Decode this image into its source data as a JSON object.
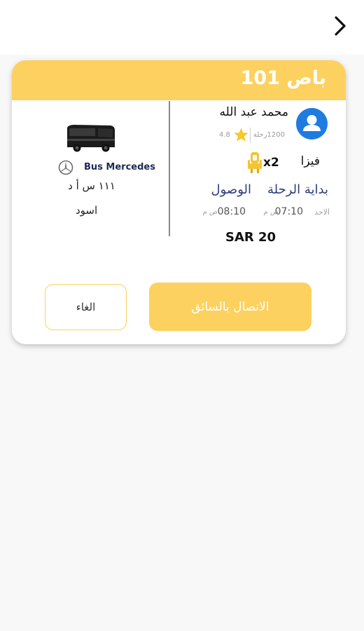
{
  "nav": {
    "back_icon": "chevron-right-icon"
  },
  "trip": {
    "bus_title": "باص 101",
    "driver": {
      "name": "محمد عبد الله",
      "trips": "1200رحلة",
      "rating": "4.8",
      "avatar_icon": "person-icon"
    },
    "payment_method": "فيزا",
    "seats": "x2",
    "start_label": "بداية الرحلة",
    "arrival_label": "الوصول",
    "start_day": "الاحد",
    "start_time": "07:10",
    "start_ampm": "ص م",
    "arrival_time": "08:10",
    "arrival_ampm": "ص م",
    "price": "SAR 20",
    "bus": {
      "model": "Bus Mercedes",
      "plate": "١١١ س أ د",
      "color": "اسود",
      "brand_icon": "mercedes-logo-icon"
    }
  },
  "actions": {
    "contact_label": "الاتصال بالسائق",
    "cancel_label": "الغاء"
  },
  "colors": {
    "accent": "#fdd15f",
    "label_blue": "#2c3d7e",
    "avatar_blue": "#1e7be0"
  }
}
